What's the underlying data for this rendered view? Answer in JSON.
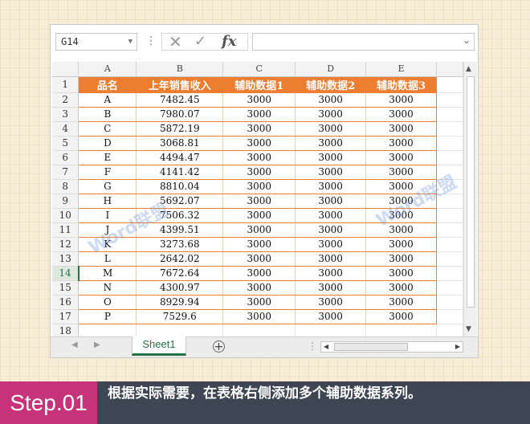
{
  "formula_bar": {
    "name_box": "G14",
    "formula": "",
    "cancel_icon": "x-icon",
    "enter_icon": "check-icon",
    "function_label": "fx"
  },
  "columns": [
    "A",
    "B",
    "C",
    "D",
    "E"
  ],
  "header_row": [
    "品名",
    "上年销售收入",
    "辅助数据1",
    "辅助数据2",
    "辅助数据3"
  ],
  "rows": [
    [
      "A",
      "7482.45",
      "3000",
      "3000",
      "3000"
    ],
    [
      "B",
      "7980.07",
      "3000",
      "3000",
      "3000"
    ],
    [
      "C",
      "5872.19",
      "3000",
      "3000",
      "3000"
    ],
    [
      "D",
      "3068.81",
      "3000",
      "3000",
      "3000"
    ],
    [
      "E",
      "4494.47",
      "3000",
      "3000",
      "3000"
    ],
    [
      "F",
      "4141.42",
      "3000",
      "3000",
      "3000"
    ],
    [
      "G",
      "8810.04",
      "3000",
      "3000",
      "3000"
    ],
    [
      "H",
      "5692.07",
      "3000",
      "3000",
      "3000"
    ],
    [
      "I",
      "7506.32",
      "3000",
      "3000",
      "3000"
    ],
    [
      "J",
      "4399.51",
      "3000",
      "3000",
      "3000"
    ],
    [
      "K",
      "3273.68",
      "3000",
      "3000",
      "3000"
    ],
    [
      "L",
      "2642.02",
      "3000",
      "3000",
      "3000"
    ],
    [
      "M",
      "7672.64",
      "3000",
      "3000",
      "3000"
    ],
    [
      "N",
      "4300.97",
      "3000",
      "3000",
      "3000"
    ],
    [
      "O",
      "8929.94",
      "3000",
      "3000",
      "3000"
    ],
    [
      "P",
      "7529.6",
      "3000",
      "3000",
      "3000"
    ]
  ],
  "row_numbers": [
    "1",
    "2",
    "3",
    "4",
    "5",
    "6",
    "7",
    "8",
    "9",
    "10",
    "11",
    "12",
    "13",
    "14",
    "15",
    "16",
    "17",
    "18"
  ],
  "selected_row": "14",
  "sheet_tab": "Sheet1",
  "watermark": "Word联盟",
  "colors": {
    "header_fill": "#ed7d31",
    "excel_green": "#217346",
    "step_badge": "#c8327a",
    "caption_bar": "#3d4652"
  },
  "step": {
    "label": "Step.01",
    "caption": "根据实际需要，在表格右侧添加多个辅助数据系列。"
  }
}
